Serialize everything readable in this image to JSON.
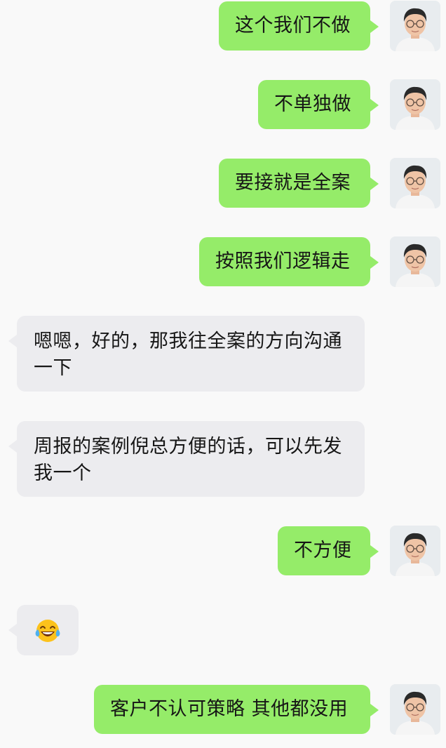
{
  "messages": [
    {
      "side": "out",
      "text": "这个我们不做"
    },
    {
      "side": "out",
      "text": "不单独做"
    },
    {
      "side": "out",
      "text": "要接就是全案"
    },
    {
      "side": "out",
      "text": "按照我们逻辑走"
    },
    {
      "side": "in",
      "text": "嗯嗯，好的，那我往全案的方向沟通一下"
    },
    {
      "side": "in",
      "text": "周报的案例倪总方便的话，可以先发我一个"
    },
    {
      "side": "out",
      "text": "不方便"
    },
    {
      "side": "in",
      "text": "",
      "emoji": "rolling-on-floor-laughing-tears-emoji"
    },
    {
      "side": "out",
      "text": "客户不认可策略 其他都没用"
    }
  ],
  "colors": {
    "background": "#f9f9f9",
    "outgoing_bubble": "#95ec69",
    "incoming_bubble": "#ececef",
    "text": "#161616"
  },
  "icons": {
    "avatar": "user-avatar-photo"
  }
}
